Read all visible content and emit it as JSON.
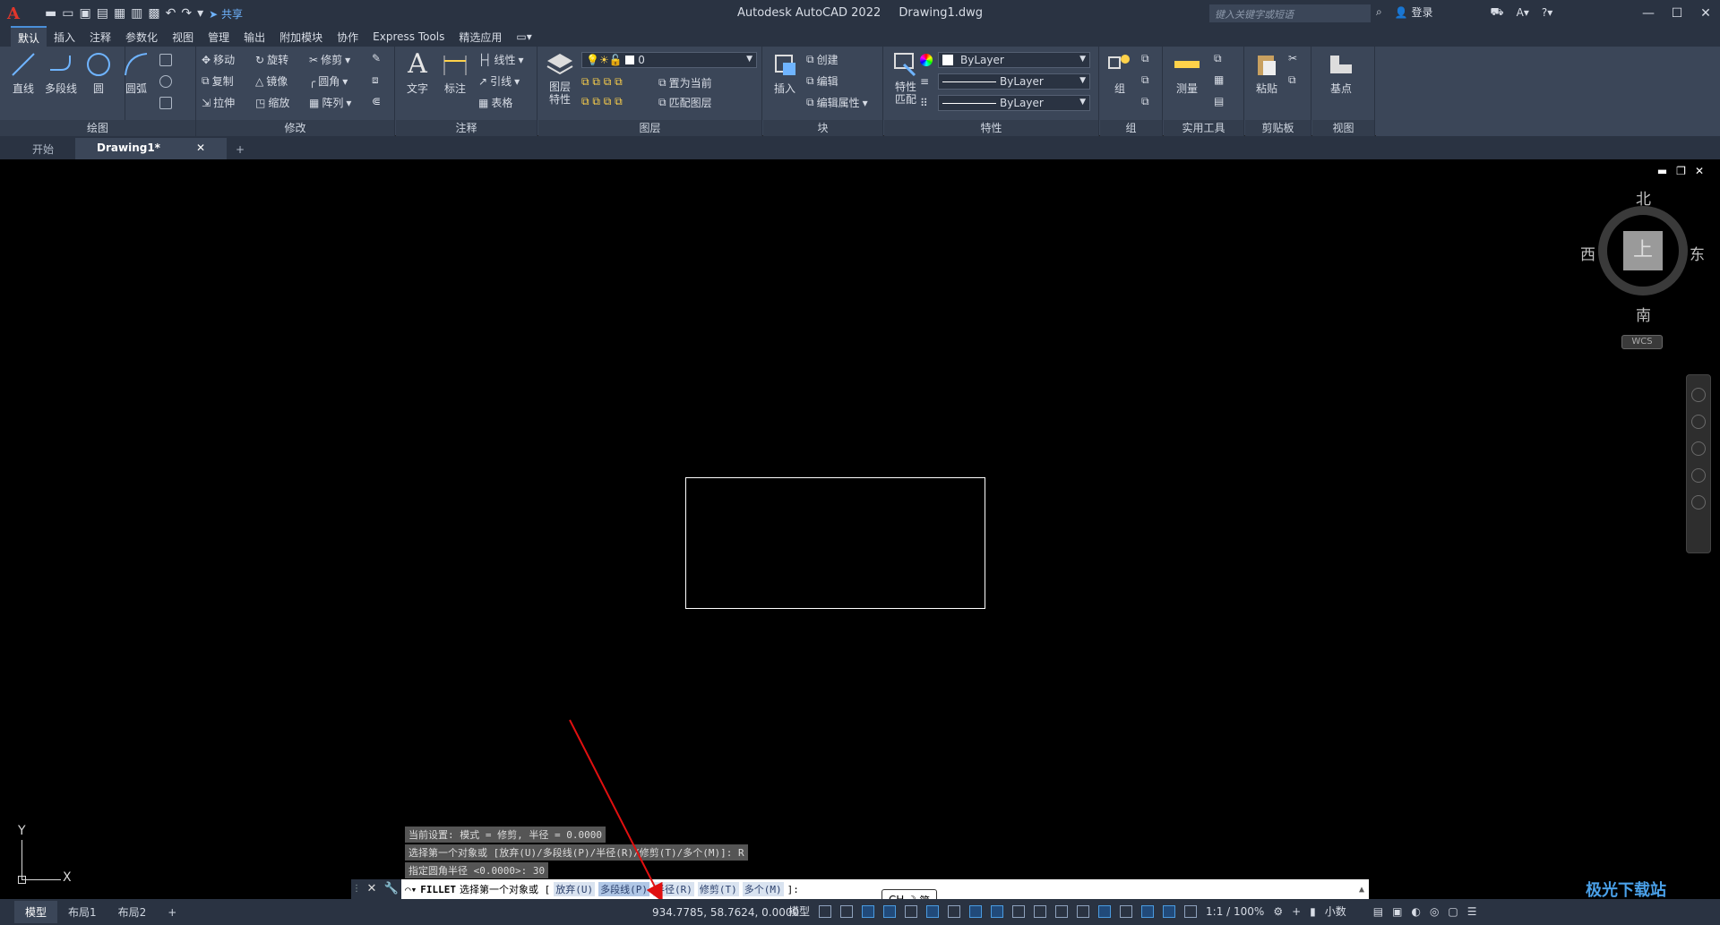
{
  "titlebar": {
    "logo": "A",
    "share": "共享",
    "app_name": "Autodesk AutoCAD 2022",
    "doc_name": "Drawing1.dwg",
    "search_placeholder": "键入关键字或短语",
    "login": "登录"
  },
  "ribbon_tabs": [
    "默认",
    "插入",
    "注释",
    "参数化",
    "视图",
    "管理",
    "输出",
    "附加模块",
    "协作",
    "Express Tools",
    "精选应用"
  ],
  "ribbon": {
    "draw": {
      "title": "绘图",
      "line": "直线",
      "polyline": "多段线",
      "circle": "圆",
      "arc": "圆弧"
    },
    "modify": {
      "title": "修改",
      "move": "移动",
      "rotate": "旋转",
      "trim": "修剪",
      "copy": "复制",
      "mirror": "镜像",
      "fillet": "圆角",
      "stretch": "拉伸",
      "scale": "缩放",
      "array": "阵列"
    },
    "annotation": {
      "title": "注释",
      "text": "文字",
      "dimension": "标注",
      "linear": "线性",
      "leader": "引线",
      "table": "表格"
    },
    "layers": {
      "title": "图层",
      "props_line1": "图层",
      "props_line2": "特性",
      "current_layer": "0",
      "set_current": "置为当前",
      "match_layer": "匹配图层"
    },
    "block": {
      "title": "块",
      "insert": "插入",
      "create": "创建",
      "edit": "编辑",
      "edit_attr": "编辑属性"
    },
    "properties": {
      "title": "特性",
      "match_line1": "特性",
      "match_line2": "匹配",
      "color": "ByLayer",
      "linetype": "ByLayer",
      "lineweight": "ByLayer"
    },
    "groups": {
      "title": "组",
      "group": "组"
    },
    "utilities": {
      "title": "实用工具",
      "measure": "测量"
    },
    "clipboard": {
      "title": "剪贴板",
      "paste": "粘贴"
    },
    "view": {
      "title": "视图",
      "base": "基点"
    }
  },
  "file_tabs": {
    "start": "开始",
    "drawing": "Drawing1*"
  },
  "viewcube": {
    "north": "北",
    "south": "南",
    "east": "东",
    "west": "西",
    "face": "上",
    "wcs": "WCS"
  },
  "ucs": {
    "x": "X",
    "y": "Y"
  },
  "command_history": [
    "当前设置: 模式 = 修剪, 半径 = 0.0000",
    "选择第一个对象或 [放弃(U)/多段线(P)/半径(R)/修剪(T)/多个(M)]: R",
    "指定圆角半径 <0.0000>: 30"
  ],
  "command_line": {
    "command": "FILLET",
    "prompt": "选择第一个对象或 [",
    "options": [
      "放弃(U)",
      "多段线(P)",
      "半径(R)",
      "修剪(T)",
      "多个(M)"
    ],
    "suffix": "]:"
  },
  "ime": {
    "label": "CH",
    "mode": "简"
  },
  "statusbar": {
    "layouts": [
      "模型",
      "布局1",
      "布局2"
    ],
    "coords": "934.7785, 58.7624, 0.0000",
    "model": "模型",
    "scale": "1:1 / 100%",
    "units": "小数"
  },
  "watermark": "极光下载站",
  "accent_color": "#4a8fd9",
  "annotation_arrow_color": "#e01010"
}
